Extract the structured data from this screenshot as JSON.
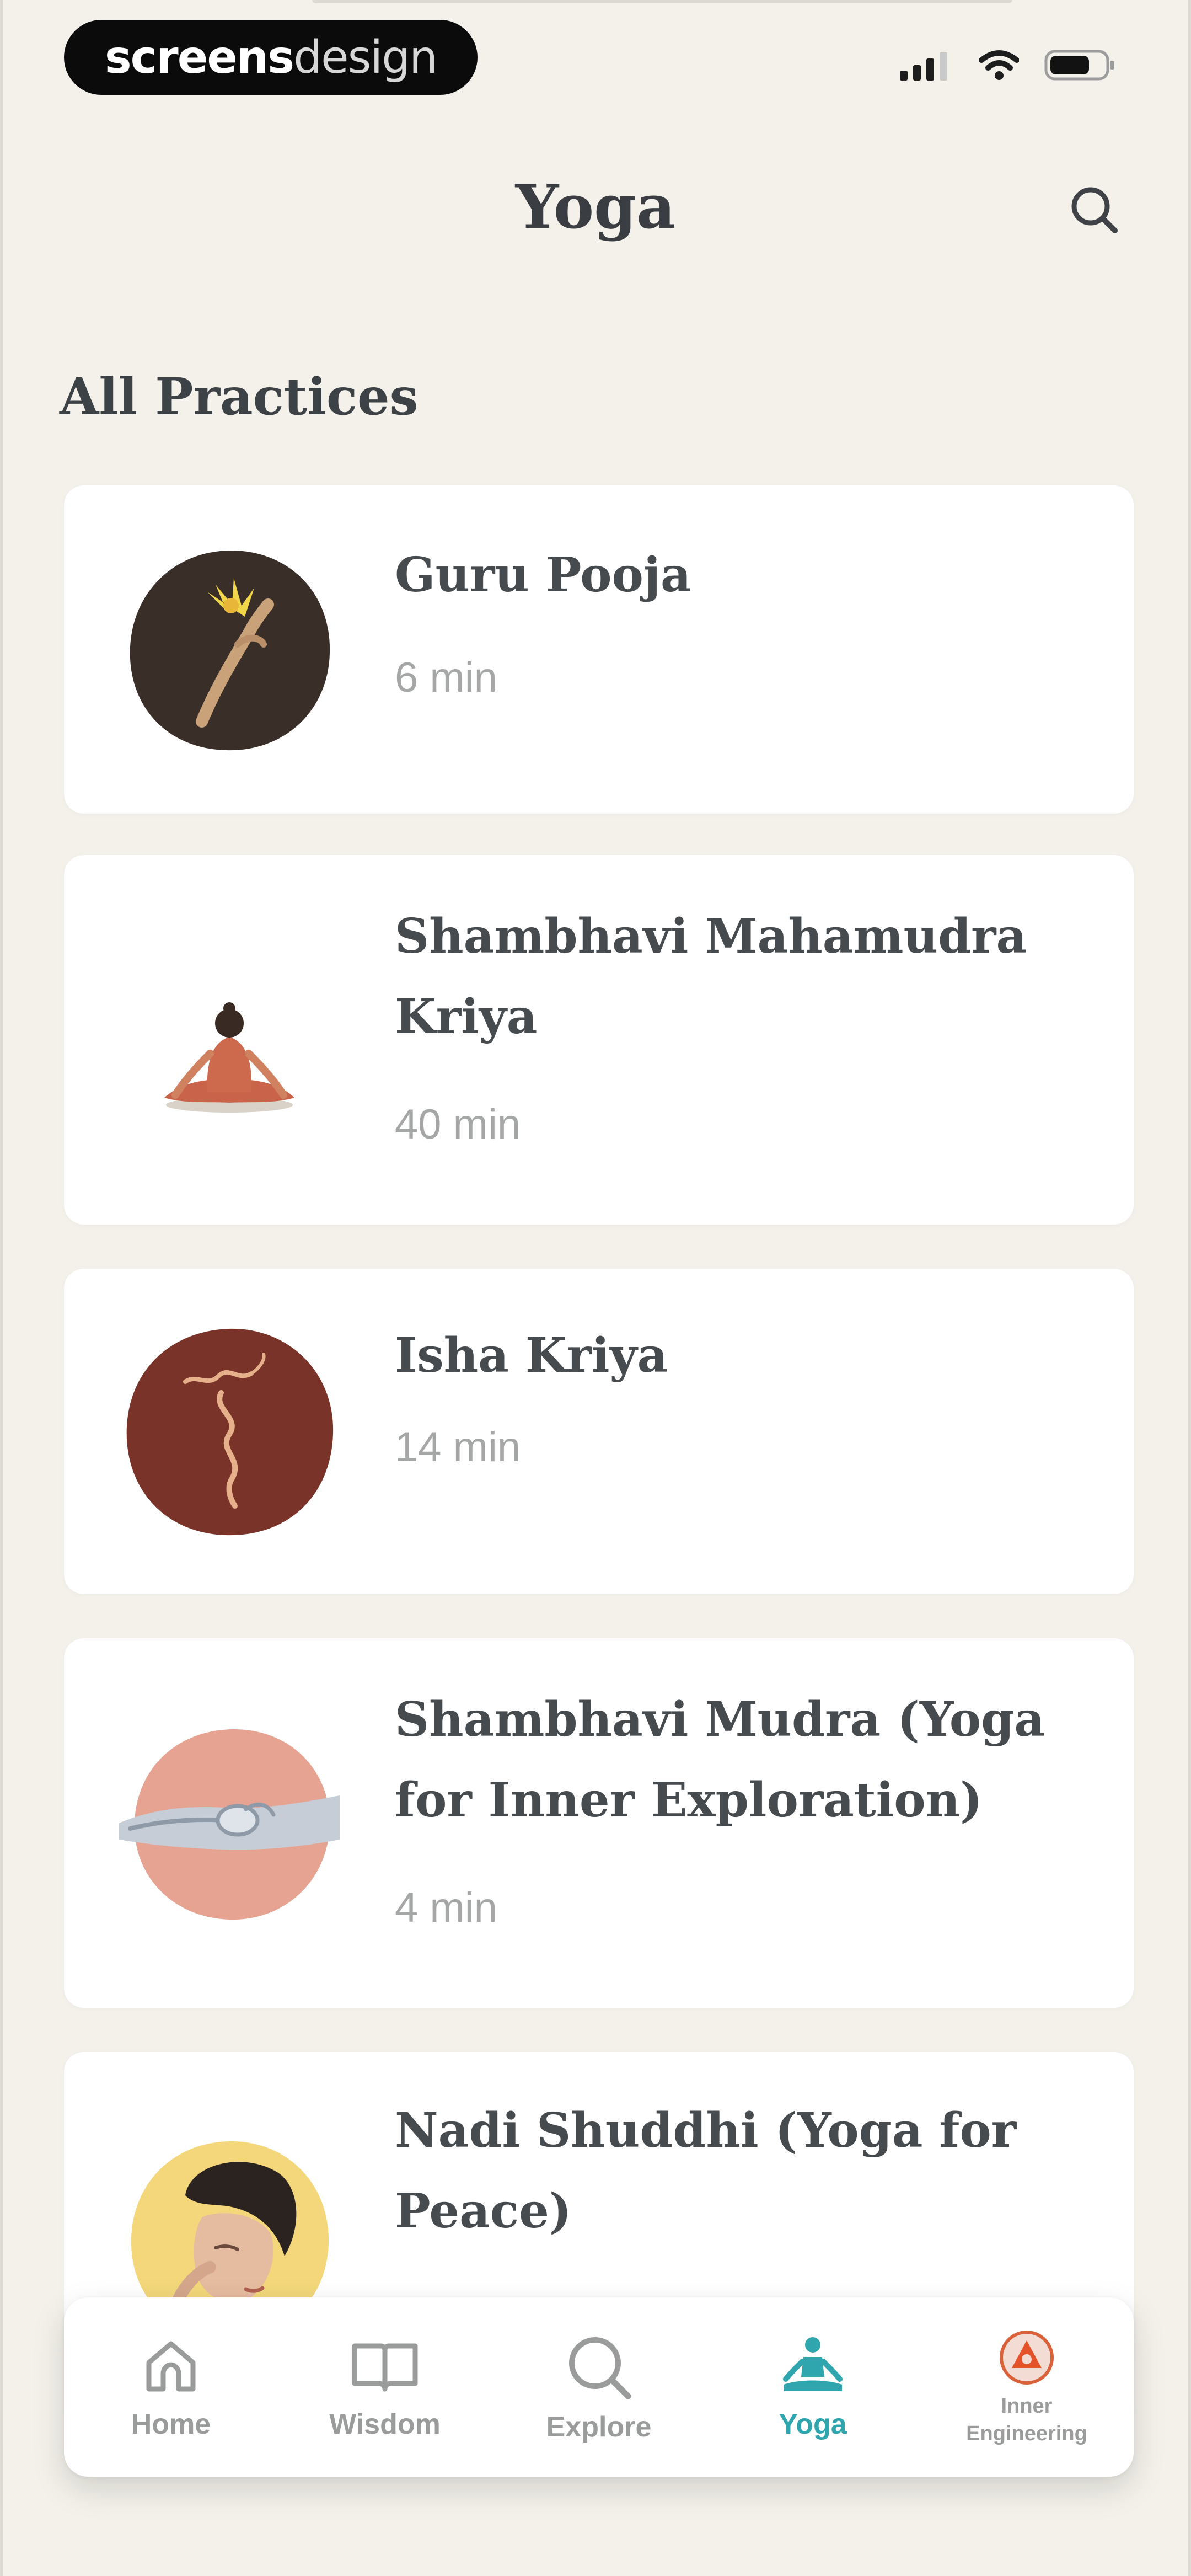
{
  "status_bar": {
    "brand_bold": "screens",
    "brand_light": "design"
  },
  "header": {
    "title": "Yoga"
  },
  "section": {
    "heading": "All Practices"
  },
  "practices": [
    {
      "title": "Guru Pooja",
      "duration": "6 min"
    },
    {
      "title": "Shambhavi Mahamudra Kriya",
      "duration": "40 min"
    },
    {
      "title": "Isha Kriya",
      "duration": "14 min"
    },
    {
      "title": "Shambhavi Mudra (Yoga for Inner Exploration)",
      "duration": "4 min"
    },
    {
      "title": "Nadi Shuddhi (Yoga for Peace)",
      "duration": ""
    }
  ],
  "bottom_nav": {
    "items": [
      {
        "label": "Home",
        "icon": "home-icon"
      },
      {
        "label": "Wisdom",
        "icon": "book-icon"
      },
      {
        "label": "Explore",
        "icon": "search-icon"
      },
      {
        "label": "Yoga",
        "icon": "meditation-icon",
        "active": true
      },
      {
        "label": "Inner Engineering",
        "icon": "inner-engineering-icon"
      }
    ]
  },
  "colors": {
    "background": "#f3f1ea",
    "card": "#ffffff",
    "title_text": "#3a3e42",
    "muted_text": "#a5a7a7",
    "accent": "#2fa6ad"
  }
}
